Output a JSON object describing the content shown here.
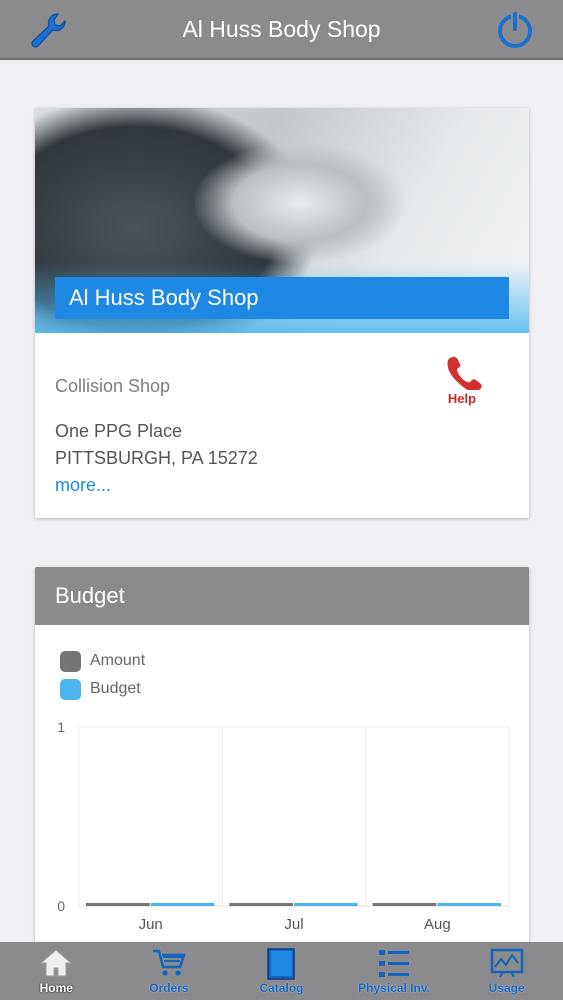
{
  "header": {
    "title": "Al Huss Body Shop",
    "left_icon": "wrench-icon",
    "right_icon": "power-icon"
  },
  "shop": {
    "banner_name": "Al Huss Body Shop",
    "type": "Collision Shop",
    "address_line1": "One PPG Place",
    "address_line2": "PITTSBURGH, PA 15272",
    "more_link": "more...",
    "help_label": "Help",
    "help_icon": "phone-icon"
  },
  "budget": {
    "title": "Budget",
    "legend": [
      {
        "label": "Amount",
        "color": "#757575"
      },
      {
        "label": "Budget",
        "color": "#4fb3ec"
      }
    ]
  },
  "chart_data": {
    "type": "bar",
    "categories": [
      "Jun",
      "Jul",
      "Aug"
    ],
    "series": [
      {
        "name": "Amount",
        "values": [
          0,
          0,
          0
        ]
      },
      {
        "name": "Budget",
        "values": [
          0,
          0,
          0
        ]
      }
    ],
    "ylim": [
      0,
      1
    ],
    "yticks": [
      "0",
      "1"
    ],
    "legend": "top-left",
    "grid": true
  },
  "tabs": [
    {
      "label": "Home",
      "icon": "home-icon",
      "active": true
    },
    {
      "label": "Orders",
      "icon": "cart-icon",
      "active": false
    },
    {
      "label": "Catalog",
      "icon": "book-icon",
      "active": false
    },
    {
      "label": "Physical Inv.",
      "icon": "list-icon",
      "active": false
    },
    {
      "label": "Usage",
      "icon": "usage-chart-icon",
      "active": false
    }
  ],
  "colors": {
    "header_bg": "#8b8b8d",
    "accent": "#1e88e5",
    "help": "#c62828"
  }
}
